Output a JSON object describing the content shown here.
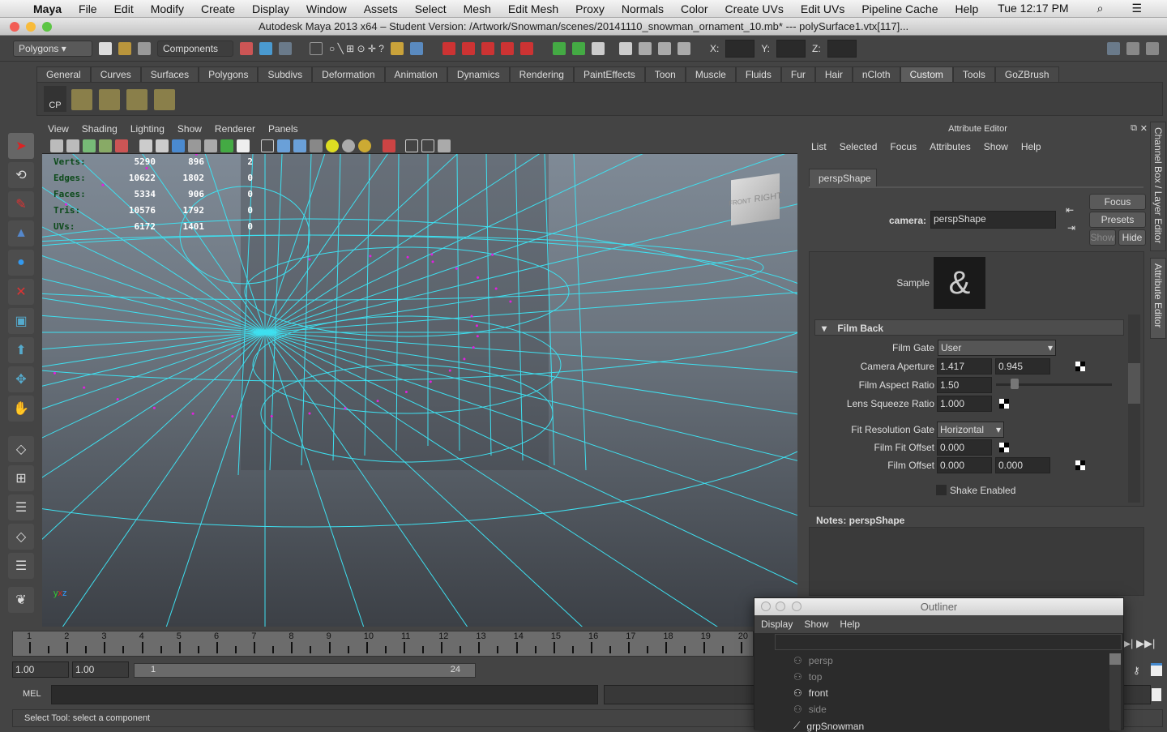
{
  "mac_menu": {
    "apple": "",
    "app": "Maya",
    "items": [
      "File",
      "Edit",
      "Modify",
      "Create",
      "Display",
      "Window",
      "Assets",
      "Select",
      "Mesh",
      "Edit Mesh",
      "Proxy",
      "Normals",
      "Color",
      "Create UVs",
      "Edit UVs",
      "Pipeline Cache",
      "Help"
    ],
    "clock": "Tue 12:17 PM"
  },
  "window_title": "Autodesk Maya 2013 x64 – Student Version: /Artwork/Snowman/scenes/20141110_snowman_ornament_10.mb*  ---  polySurface1.vtx[117]...",
  "status_line": {
    "menu_set": "Polygons",
    "selection_mode": "Components",
    "x_label": "X:",
    "y_label": "Y:",
    "z_label": "Z:"
  },
  "shelf": {
    "tabs": [
      "General",
      "Curves",
      "Surfaces",
      "Polygons",
      "Subdivs",
      "Deformation",
      "Animation",
      "Dynamics",
      "Rendering",
      "PaintEffects",
      "Toon",
      "Muscle",
      "Fluids",
      "Fur",
      "Hair",
      "nCloth",
      "Custom",
      "Tools",
      "GoZBrush"
    ],
    "active_tab": "Custom",
    "cp_label": "CP"
  },
  "viewport": {
    "menus": [
      "View",
      "Shading",
      "Lighting",
      "Show",
      "Renderer",
      "Panels"
    ],
    "hud": [
      {
        "label": "Verts:",
        "values": [
          "5290",
          "896",
          "2"
        ]
      },
      {
        "label": "Edges:",
        "values": [
          "10622",
          "1802",
          "0"
        ]
      },
      {
        "label": "Faces:",
        "values": [
          "5334",
          "906",
          "0"
        ]
      },
      {
        "label": "Tris:",
        "values": [
          "10576",
          "1792",
          "0"
        ]
      },
      {
        "label": "UVs:",
        "values": [
          "6172",
          "1401",
          "0"
        ]
      }
    ],
    "view_cube": {
      "right": "RIGHT",
      "front": "FRONT"
    },
    "wire_color": "#3ee0f0",
    "vertex_color": "#e020e0"
  },
  "attribute_editor": {
    "title": "Attribute Editor",
    "menus": [
      "List",
      "Selected",
      "Focus",
      "Attributes",
      "Show",
      "Help"
    ],
    "tab": "perspShape",
    "camera_label": "camera:",
    "camera_value": "perspShape",
    "buttons": {
      "focus": "Focus",
      "presets": "Presets",
      "show": "Show",
      "hide": "Hide"
    },
    "sample_label": "Sample",
    "section": "Film Back",
    "film_gate_label": "Film Gate",
    "film_gate": "User",
    "camera_aperture_label": "Camera Aperture",
    "camera_aperture": [
      "1.417",
      "0.945"
    ],
    "film_aspect_label": "Film Aspect Ratio",
    "film_aspect": "1.50",
    "lens_squeeze_label": "Lens Squeeze Ratio",
    "lens_squeeze": "1.000",
    "fit_res_label": "Fit Resolution Gate",
    "fit_res": "Horizontal",
    "film_fit_offset_label": "Film Fit Offset",
    "film_fit_offset": "0.000",
    "film_offset_label": "Film Offset",
    "film_offset": [
      "0.000",
      "0.000"
    ],
    "shake_label": "Shake Enabled",
    "notes": "Notes:  perspShape"
  },
  "side_tabs": [
    "Channel Box / Layer Editor",
    "Attribute Editor"
  ],
  "timeline": {
    "ticks": [
      "1",
      "2",
      "3",
      "4",
      "5",
      "6",
      "7",
      "8",
      "9",
      "10",
      "11",
      "12",
      "13",
      "14",
      "15",
      "16",
      "17",
      "18",
      "19",
      "20"
    ]
  },
  "range": {
    "start": "1.00",
    "start2": "1.00",
    "inner_start": "1",
    "inner_end": "24"
  },
  "mel_label": "MEL",
  "help_line": "Select Tool: select a component",
  "outliner": {
    "title": "Outliner",
    "menus": [
      "Display",
      "Show",
      "Help"
    ],
    "items": [
      {
        "name": "persp",
        "dim": true
      },
      {
        "name": "top",
        "dim": true
      },
      {
        "name": "front",
        "dim": false
      },
      {
        "name": "side",
        "dim": true
      },
      {
        "name": "grpSnowman",
        "dim": false
      }
    ]
  }
}
